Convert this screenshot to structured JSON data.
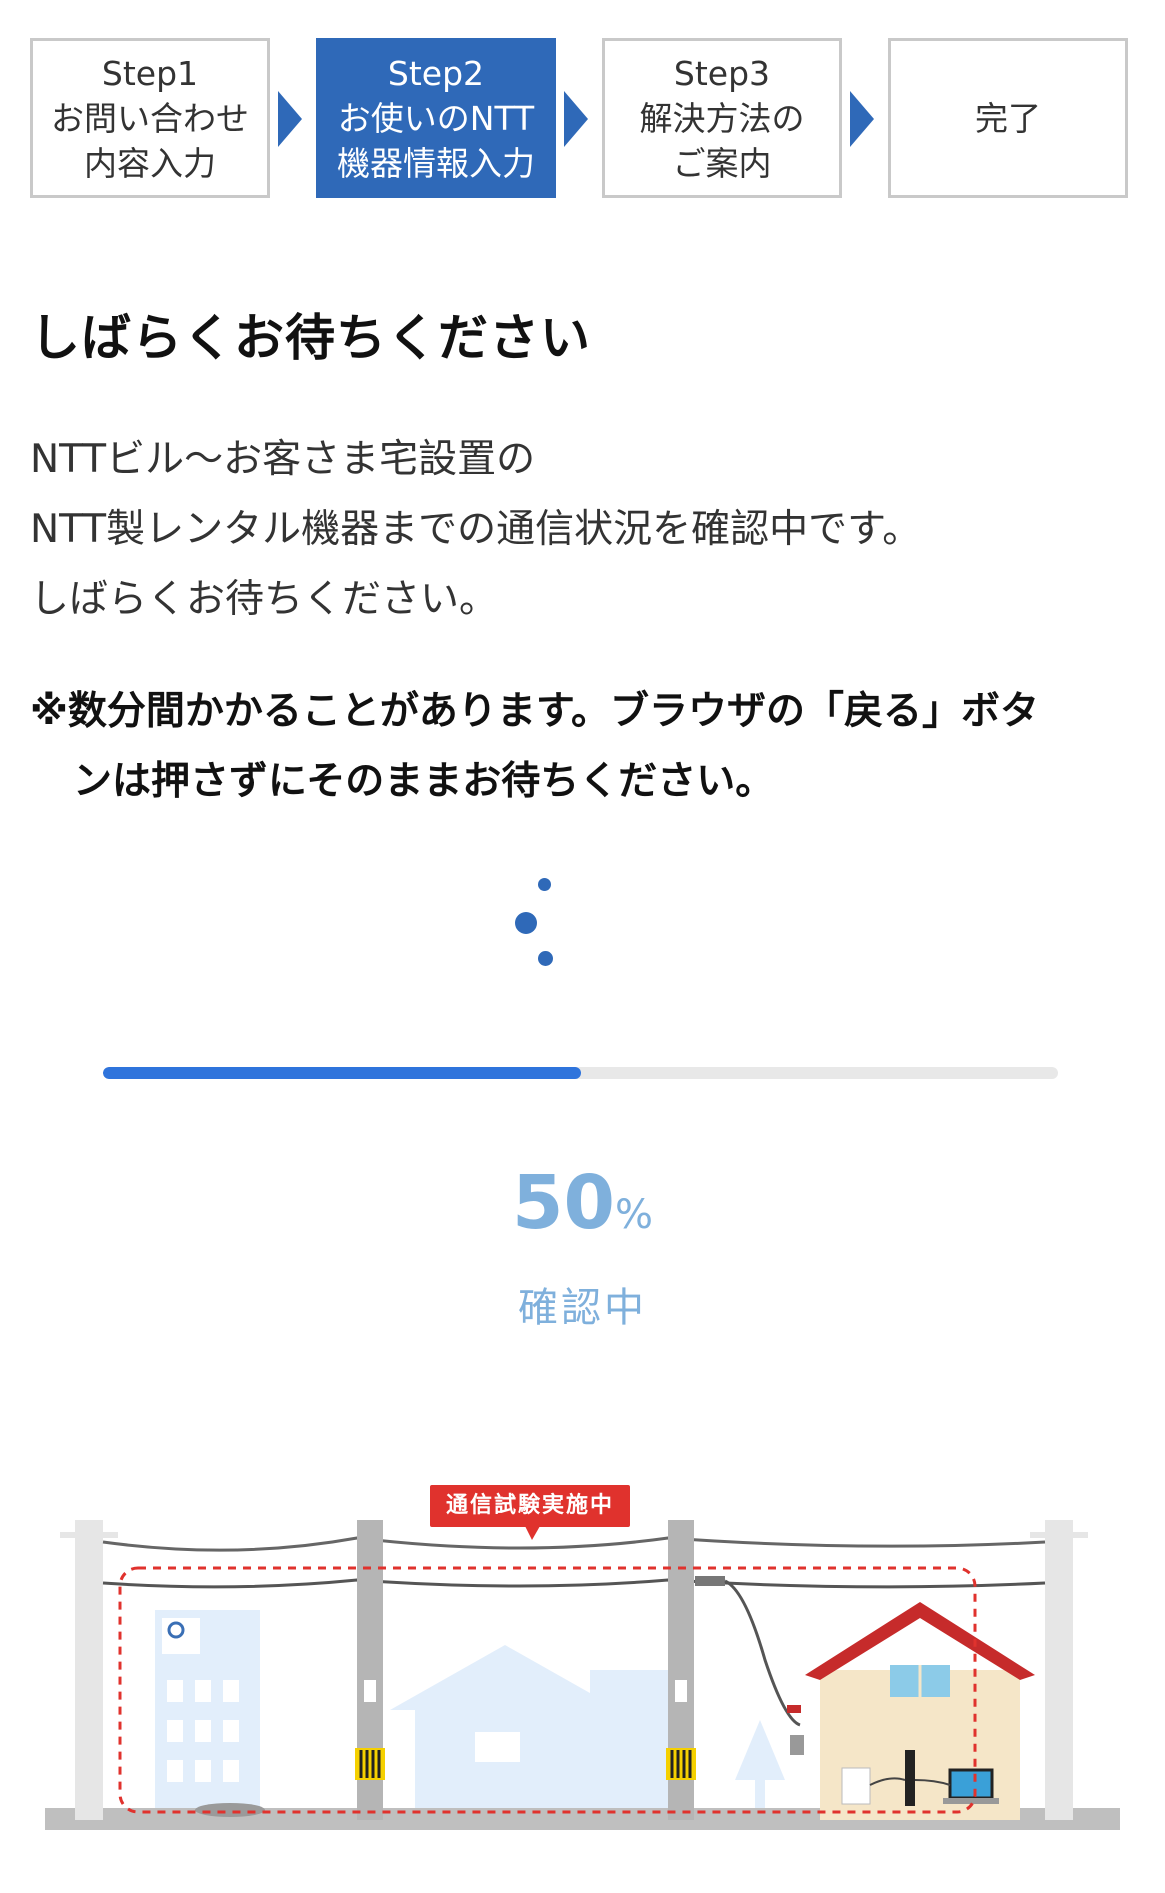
{
  "steps": [
    {
      "line1": "Step1",
      "line2": "お問い合わせ",
      "line3": "内容入力",
      "active": false
    },
    {
      "line1": "Step2",
      "line2": "お使いのNTT",
      "line3": "機器情報入力",
      "active": true
    },
    {
      "line1": "Step3",
      "line2": "解決方法の",
      "line3": "ご案内",
      "active": false
    },
    {
      "label": "完了",
      "active": false
    }
  ],
  "heading": "しばらくお待ちください",
  "description": [
    "NTTビル〜お客さま宅設置の",
    "NTT製レンタル機器までの通信状況を確認中です。",
    "しばらくお待ちください。"
  ],
  "note": {
    "line1": "※数分間かかることがあります。ブラウザの「戻る」ボタ",
    "line2": "ンは押さずにそのままお待ちください。"
  },
  "progress": {
    "percent": 50,
    "value_text": "50",
    "unit": "%",
    "status": "確認中"
  },
  "illustration": {
    "badge": "通信試験実施中",
    "building_logo": "NTT"
  },
  "colors": {
    "accent": "#2f69b8",
    "progress": "#2f74dc",
    "percent_text": "#7fb0dc",
    "badge": "#e0322d"
  }
}
